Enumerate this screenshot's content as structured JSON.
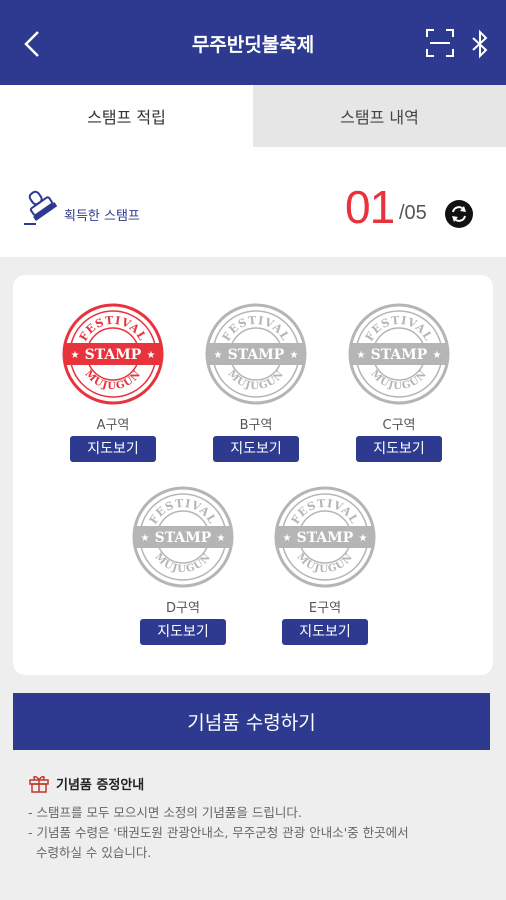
{
  "header": {
    "title": "무주반딧불축제",
    "back_icon": "chevron-left-icon",
    "scan_icon": "qr-scan-icon",
    "bluetooth_icon": "bluetooth-icon"
  },
  "tabs": [
    {
      "label": "스탬프 적립",
      "active": true
    },
    {
      "label": "스탬프 내역",
      "active": false
    }
  ],
  "summary": {
    "label": "획득한 스탬프",
    "acquired": "01",
    "total": "/05",
    "refresh_icon": "refresh-icon",
    "stamp_icon": "stamp-icon"
  },
  "stamps": [
    {
      "zone": "A구역",
      "collected": true,
      "button": "지도보기"
    },
    {
      "zone": "B구역",
      "collected": false,
      "button": "지도보기"
    },
    {
      "zone": "C구역",
      "collected": false,
      "button": "지도보기"
    },
    {
      "zone": "D구역",
      "collected": false,
      "button": "지도보기"
    },
    {
      "zone": "E구역",
      "collected": false,
      "button": "지도보기"
    }
  ],
  "stamp_text": {
    "top": "FESTIVAL",
    "center": "STAMP",
    "bottom": "MUJUGUN"
  },
  "claim_button": "기념품 수령하기",
  "guide": {
    "title": "기념품 증정안내",
    "icon": "gift-icon",
    "lines": [
      "- 스탬프를 모두 모으시면 소정의 기념품을 드립니다.",
      "- 기념품 수령은 '태권도원 관광안내소, 무주군청 관광 안내소'중  한곳에서",
      "  수령하실 수 있습니다."
    ]
  },
  "colors": {
    "brand": "#2e3a8f",
    "accent": "#e8323c",
    "inactive_stamp": "#b5b5b5"
  }
}
